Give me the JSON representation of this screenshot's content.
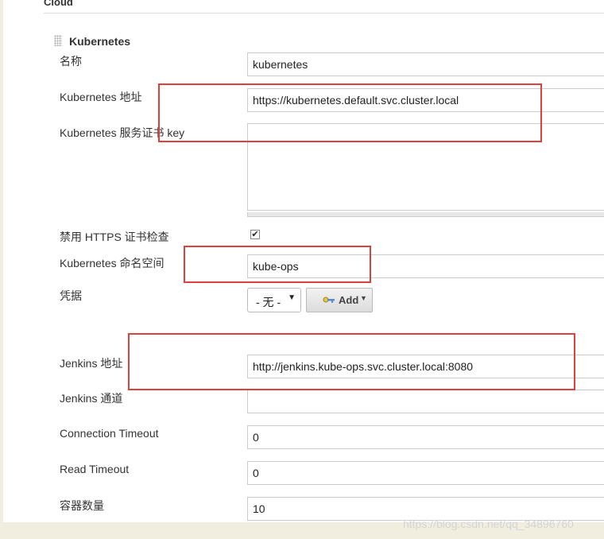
{
  "section": {
    "title": "Cloud"
  },
  "cloud": {
    "name": "Kubernetes"
  },
  "form": {
    "name": {
      "label": "名称",
      "value": "kubernetes"
    },
    "k8s_url": {
      "label": "Kubernetes 地址",
      "value": "https://kubernetes.default.svc.cluster.local"
    },
    "server_cert": {
      "label": "Kubernetes 服务证书 key",
      "value": ""
    },
    "skip_tls": {
      "label": "禁用 HTTPS 证书检查",
      "checked_glyph": "✔"
    },
    "namespace": {
      "label": "Kubernetes 命名空间",
      "value": "kube-ops"
    },
    "credentials": {
      "label": "凭据",
      "selected": "- 无 -",
      "add_label": "Add"
    },
    "jenkins_url": {
      "label": "Jenkins 地址",
      "value": "http://jenkins.kube-ops.svc.cluster.local:8080"
    },
    "jenkins_tunnel": {
      "label": "Jenkins 通道",
      "value": ""
    },
    "connection_timeout": {
      "label": "Connection Timeout",
      "value": "0"
    },
    "read_timeout": {
      "label": "Read Timeout",
      "value": "0"
    },
    "container_cap": {
      "label": "容器数量",
      "value": "10"
    }
  },
  "watermark": "https://blog.csdn.net/qq_34896760",
  "colors": {
    "annotation": "#e0403c",
    "background": "#f1eee0"
  }
}
